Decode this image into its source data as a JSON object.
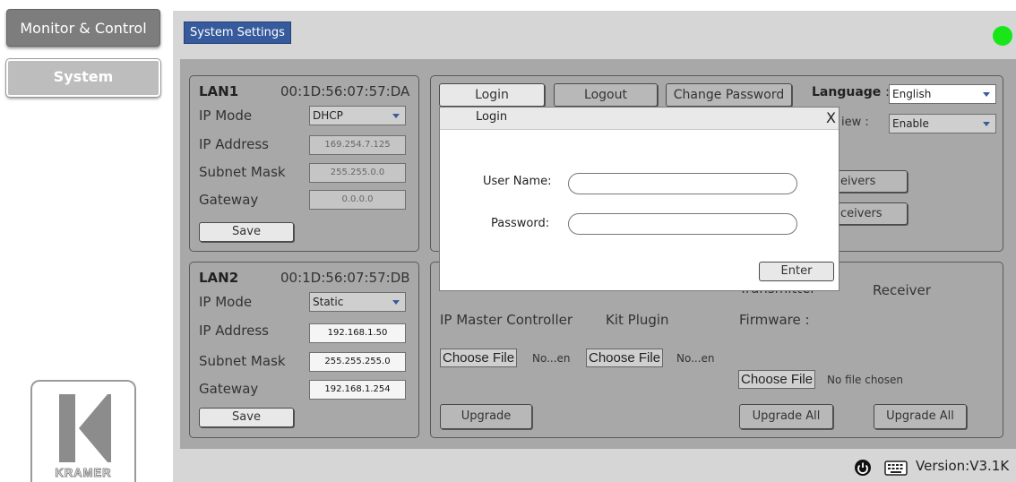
{
  "nav": {
    "monitor_control": "Monitor & Control",
    "system": "System"
  },
  "logo": {
    "text": "KRAMER"
  },
  "header": {
    "tab_label": "System Settings",
    "status_color": "#19e619"
  },
  "lan1": {
    "title": "LAN1",
    "mac": "00:1D:56:07:57:DA",
    "ip_mode_label": "IP Mode",
    "ip_mode_value": "DHCP",
    "ip_address_label": "IP Address",
    "ip_address_value": "169.254.7.125",
    "subnet_label": "Subnet Mask",
    "subnet_value": "255.255.0.0",
    "gateway_label": "Gateway",
    "gateway_value": "0.0.0.0",
    "save": "Save"
  },
  "lan2": {
    "title": "LAN2",
    "mac": "00:1D:56:07:57:DB",
    "ip_mode_label": "IP Mode",
    "ip_mode_value": "Static",
    "ip_address_label": "IP Address",
    "ip_address_value": "192.168.1.50",
    "subnet_label": "Subnet Mask",
    "subnet_value": "255.255.255.0",
    "gateway_label": "Gateway",
    "gateway_value": "192.168.1.254",
    "save": "Save"
  },
  "account": {
    "login": "Login",
    "logout": "Logout",
    "change_password": "Change Password",
    "language_label": "Language",
    "language_sep": ":",
    "language_value": "English",
    "preview_label_partial": "iew :",
    "preview_value": "Enable",
    "receivers_btn1_partial": "eivers",
    "receivers_btn2_partial": "ceivers"
  },
  "upgrade": {
    "transmitter_partial": "Transmitter",
    "receiver_label": "Receiver",
    "ip_master_controller": "IP Master Controller",
    "kit_plugin": "Kit Plugin",
    "firmware_label": "Firmware :",
    "choose_file": "Choose File",
    "file_short1": "No...en",
    "file_short2": "No...en",
    "no_file_chosen": "No file chosen",
    "upgrade": "Upgrade",
    "upgrade_all_1": "Upgrade All",
    "upgrade_all_2": "Upgrade All"
  },
  "login_modal": {
    "title": "Login",
    "close": "X",
    "username_label": "User Name:",
    "password_label": "Password:",
    "username_value": "",
    "password_value": "",
    "enter": "Enter"
  },
  "footer": {
    "version": "Version:V3.1K"
  },
  "icons": {
    "power": "power-icon",
    "keyboard": "keyboard-icon"
  }
}
